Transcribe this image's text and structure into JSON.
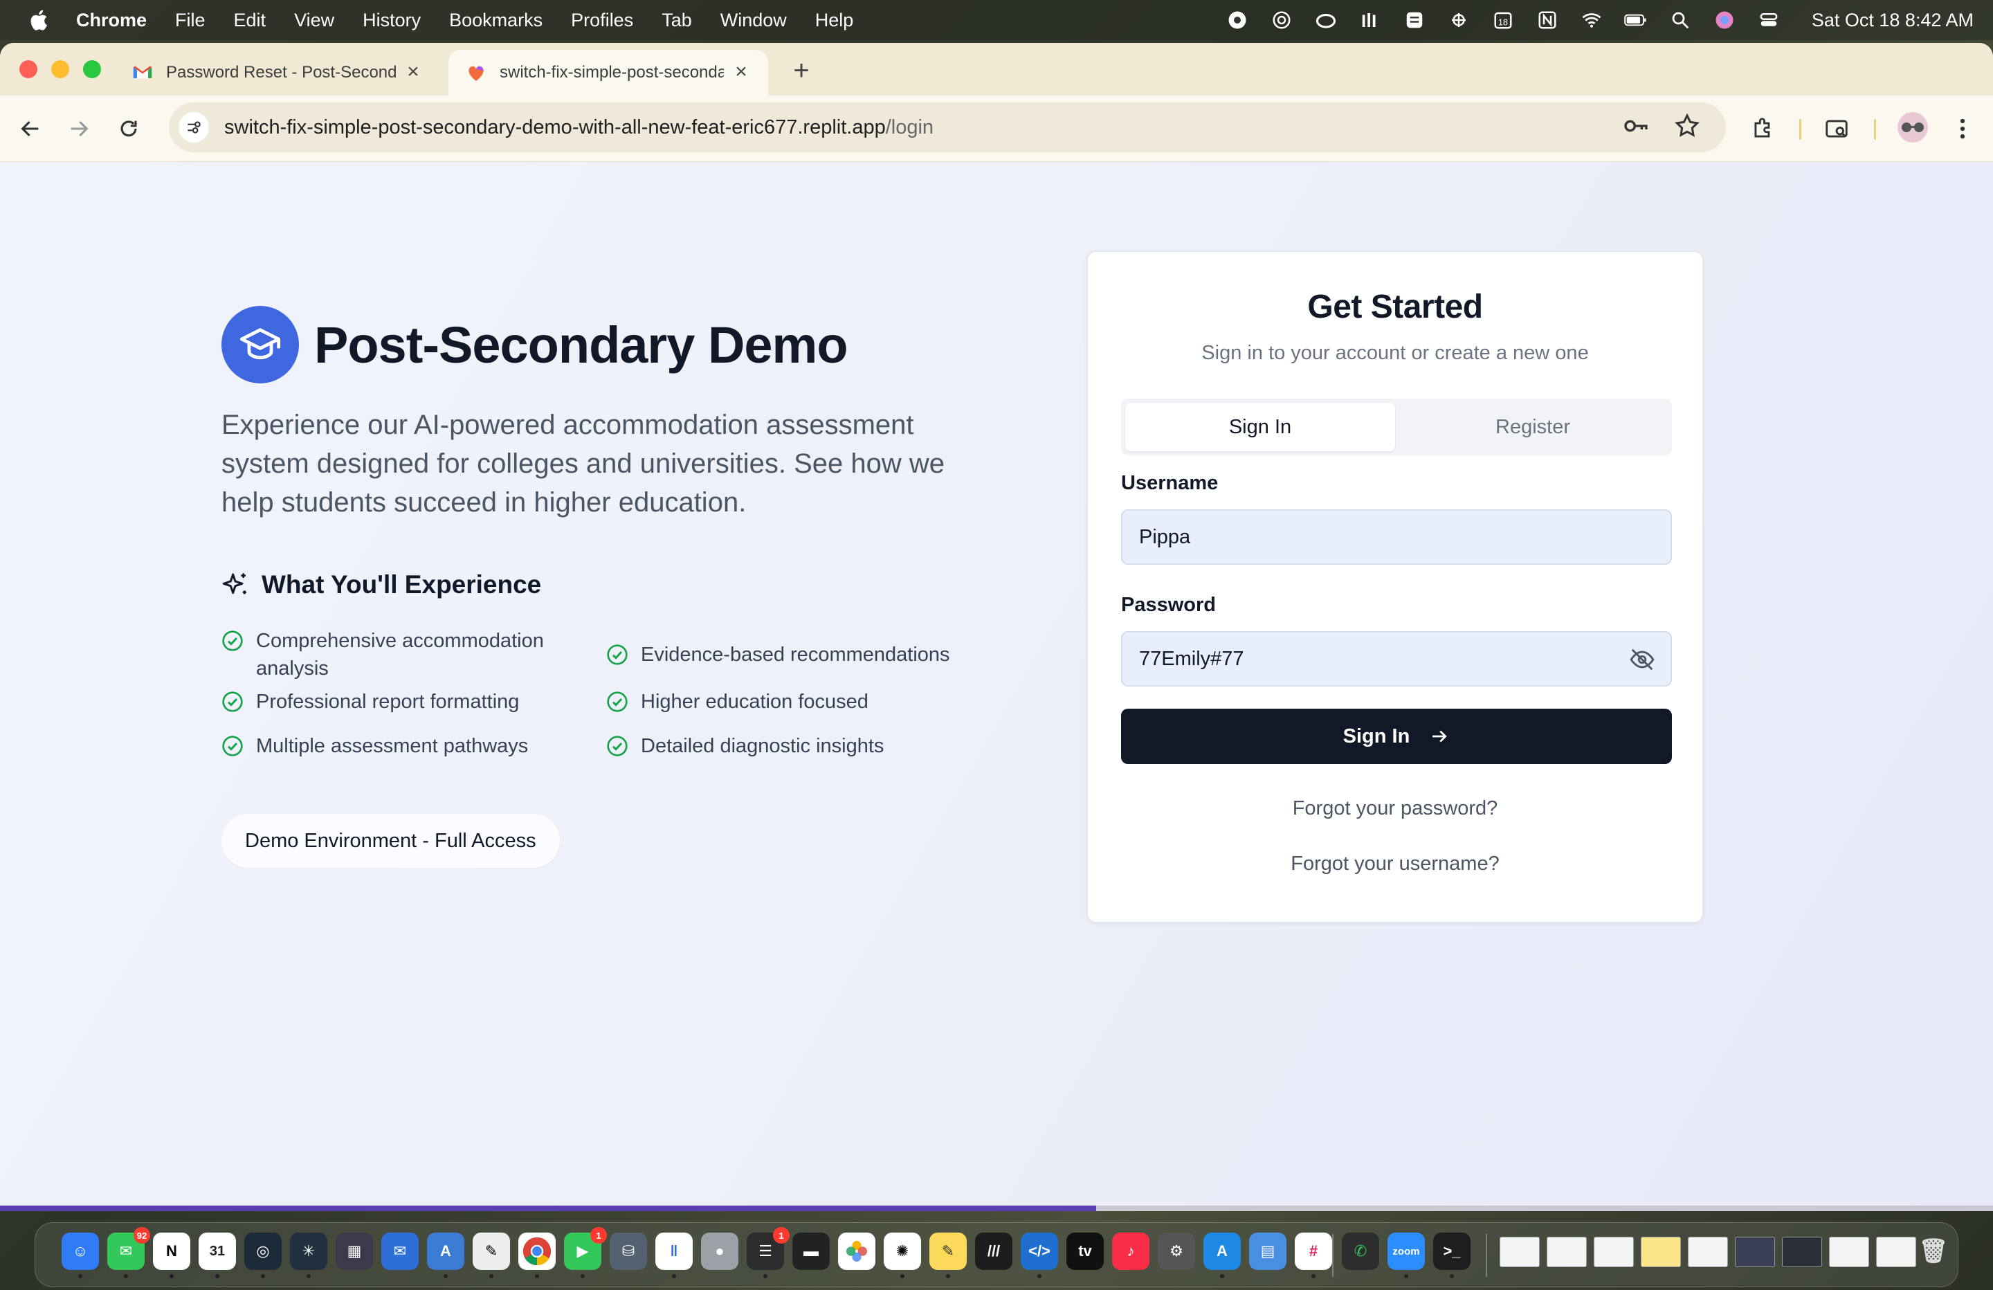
{
  "menubar": {
    "app": "Chrome",
    "items": [
      "File",
      "Edit",
      "View",
      "History",
      "Bookmarks",
      "Profiles",
      "Tab",
      "Window",
      "Help"
    ],
    "calendar_day": "18",
    "clock": "Sat Oct 18  8:42 AM"
  },
  "browser": {
    "tabs": [
      {
        "title": "Password Reset - Post-Secondary",
        "icon": "gmail-icon"
      },
      {
        "title": "switch-fix-simple-post-secondary",
        "icon": "replit-icon"
      }
    ],
    "new_tab": "+",
    "url_host": "switch-fix-simple-post-secondary-demo-with-all-new-feat-eric677.replit.app",
    "url_path": "/login"
  },
  "hero": {
    "title": "Post-Secondary Demo",
    "description": "Experience our AI-powered accommodation assessment system designed for colleges and universities. See how we help students succeed in higher education.",
    "experience_title": "What You'll Experience",
    "features_left": [
      "Comprehensive accommodation analysis",
      "Professional report formatting",
      "Multiple assessment pathways"
    ],
    "features_right": [
      "Evidence-based recommendations",
      "Higher education focused",
      "Detailed diagnostic insights"
    ],
    "demo_pill": "Demo Environment - Full Access"
  },
  "auth": {
    "title": "Get Started",
    "subtitle": "Sign in to your account or create a new one",
    "tab_signin": "Sign In",
    "tab_register": "Register",
    "username_label": "Username",
    "username_value": "Pippa",
    "password_label": "Password",
    "password_value": "77Emily#77",
    "submit_label": "Sign In",
    "forgot_password": "Forgot your password?",
    "forgot_username": "Forgot your username?"
  },
  "colors": {
    "accent": "#3f67e0",
    "primary_button": "#111827",
    "check_green": "#16a34a"
  },
  "dock": {
    "badges": {
      "messages": "92",
      "facetime": "1",
      "reminders": "1"
    },
    "calendar_day": "31",
    "zoom_label": "zoom"
  }
}
